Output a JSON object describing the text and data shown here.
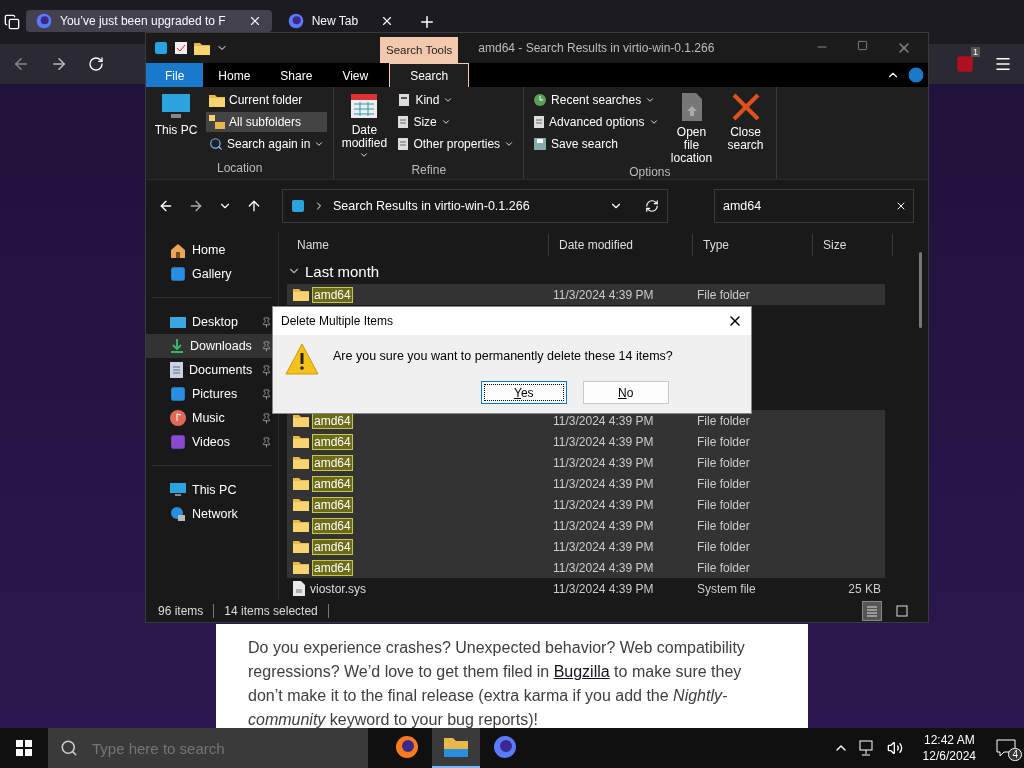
{
  "browser": {
    "tabs": [
      {
        "title": "You’ve just been upgraded to F",
        "selected": true
      },
      {
        "title": "New Tab",
        "selected": false
      }
    ],
    "extension_badge": "1",
    "article": {
      "before": "Do you experience crashes? Unexpected behavior? Web compatibility regressions? We’d love to get them filed in ",
      "link": "Bugzilla",
      "after": " to make sure they don’t make it to the final release (extra karma if you add the *Nightly-community* keyword to your bug reports)!"
    }
  },
  "explorer": {
    "title": "amd64 - Search Results in virtio-win-0.1.266",
    "context_tab": "Search Tools",
    "ribbon_tabs": [
      {
        "label": "File",
        "kind": "file",
        "selected": false
      },
      {
        "label": "Home",
        "kind": "tab",
        "selected": false
      },
      {
        "label": "Share",
        "kind": "tab",
        "selected": false
      },
      {
        "label": "View",
        "kind": "tab",
        "selected": false
      },
      {
        "label": "Search",
        "kind": "tab",
        "selected": true
      }
    ],
    "ribbon_groups": [
      {
        "label": "Location",
        "items": [
          {
            "kind": "large",
            "label": "This PC",
            "dropdown": false
          },
          {
            "kind": "stack",
            "items": [
              {
                "label": "Current folder",
                "dropdown": false,
                "selected": false
              },
              {
                "label": "All subfolders",
                "dropdown": false,
                "selected": true
              },
              {
                "label": "Search again in",
                "dropdown": true,
                "selected": false
              }
            ]
          }
        ]
      },
      {
        "label": "Refine",
        "items": [
          {
            "kind": "large",
            "label": "Date modified",
            "dropdown": true
          },
          {
            "kind": "stack",
            "items": [
              {
                "label": "Kind",
                "dropdown": true,
                "selected": false
              },
              {
                "label": "Size",
                "dropdown": true,
                "selected": false
              },
              {
                "label": "Other properties",
                "dropdown": true,
                "selected": false
              }
            ]
          }
        ]
      },
      {
        "label": "Options",
        "items": [
          {
            "kind": "stack",
            "items": [
              {
                "label": "Recent searches",
                "dropdown": true,
                "selected": false
              },
              {
                "label": "Advanced options",
                "dropdown": true,
                "selected": false
              },
              {
                "label": "Save search",
                "dropdown": false,
                "selected": false
              }
            ]
          },
          {
            "kind": "large",
            "label": "Open file location",
            "dropdown": false
          },
          {
            "kind": "large",
            "label": "Close search",
            "dropdown": false
          }
        ]
      }
    ],
    "address": "Search Results in virtio-win-0.1.266",
    "search_value": "amd64",
    "sidebar_sections": [
      {
        "items": [
          {
            "label": "Home",
            "pinned": false,
            "selected": false
          },
          {
            "label": "Gallery",
            "pinned": false,
            "selected": false
          }
        ]
      },
      {
        "items": [
          {
            "label": "Desktop",
            "pinned": true,
            "selected": false
          },
          {
            "label": "Downloads",
            "pinned": true,
            "selected": true
          },
          {
            "label": "Documents",
            "pinned": true,
            "selected": false
          },
          {
            "label": "Pictures",
            "pinned": true,
            "selected": false
          },
          {
            "label": "Music",
            "pinned": true,
            "selected": false
          },
          {
            "label": "Videos",
            "pinned": true,
            "selected": false
          }
        ]
      },
      {
        "items": [
          {
            "label": "This PC",
            "pinned": false,
            "selected": false
          },
          {
            "label": "Network",
            "pinned": false,
            "selected": false
          }
        ]
      }
    ],
    "columns": [
      "Name",
      "Date modified",
      "Type",
      "Size"
    ],
    "group": {
      "label": "Last month",
      "expanded": true
    },
    "rows": [
      {
        "name": "amd64",
        "date": "11/3/2024 4:39 PM",
        "type": "File folder",
        "kind": "folder",
        "selected": true,
        "highlighted": true
      },
      {
        "name": "amd64",
        "date": "11/3/2024 4:39 PM",
        "type": "File folder",
        "kind": "folder",
        "selected": true,
        "highlighted": true
      },
      {
        "name": "amd64",
        "date": "11/3/2024 4:39 PM",
        "type": "File folder",
        "kind": "folder",
        "selected": true,
        "highlighted": true
      },
      {
        "name": "amd64",
        "date": "11/3/2024 4:39 PM",
        "type": "File folder",
        "kind": "folder",
        "selected": true,
        "highlighted": true
      },
      {
        "name": "amd64",
        "date": "11/3/2024 4:39 PM",
        "type": "File folder",
        "kind": "folder",
        "selected": true,
        "highlighted": true
      },
      {
        "name": "amd64",
        "date": "11/3/2024 4:39 PM",
        "type": "File folder",
        "kind": "folder",
        "selected": true,
        "highlighted": true
      },
      {
        "name": "amd64",
        "date": "11/3/2024 4:39 PM",
        "type": "File folder",
        "kind": "folder",
        "selected": true,
        "highlighted": true
      },
      {
        "name": "amd64",
        "date": "11/3/2024 4:39 PM",
        "type": "File folder",
        "kind": "folder",
        "selected": true,
        "highlighted": true
      },
      {
        "name": "amd64",
        "date": "11/3/2024 4:39 PM",
        "type": "File folder",
        "kind": "folder",
        "selected": true,
        "highlighted": true
      },
      {
        "name": "viostor.sys",
        "date": "11/3/2024 4:39 PM",
        "type": "System file",
        "size": "25 KB",
        "kind": "file",
        "selected": false,
        "highlighted": false
      }
    ],
    "status": {
      "count": "96 items",
      "selection": "14 items selected"
    },
    "views": [
      {
        "selected": true
      },
      {
        "selected": false
      }
    ]
  },
  "dialog": {
    "title": "Delete Multiple Items",
    "message": "Are you sure you want to permanently delete these 14 items?",
    "buttons": [
      {
        "label": "Yes",
        "default": true
      },
      {
        "label": "No",
        "default": false
      }
    ]
  },
  "taskbar": {
    "search_placeholder": "Type here to search",
    "apps": [
      {
        "active": false
      },
      {
        "active": true
      },
      {
        "active": false
      }
    ],
    "time": "12:42 AM",
    "date": "12/6/2024",
    "notifications": "4"
  }
}
